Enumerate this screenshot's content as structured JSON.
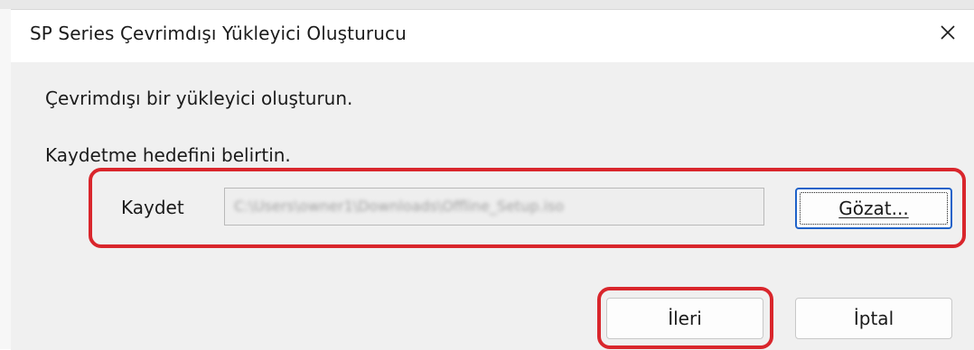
{
  "dialog": {
    "title": "SP Series Çevrimdışı Yükleyici Oluşturucu",
    "close_symbol": "×",
    "instruction_1": "Çevrimdışı bir yükleyici oluşturun.",
    "instruction_2": "Kaydetme hedefini belirtin.",
    "save_label": "Kaydet",
    "save_path": "C:\\Users\\owner1\\Downloads\\Offline_Setup.iso",
    "browse_label": "Gözat...",
    "next_label": "İleri",
    "cancel_label": "İptal"
  },
  "highlight_color": "#d9262c",
  "icons": {
    "close": "close-icon"
  }
}
